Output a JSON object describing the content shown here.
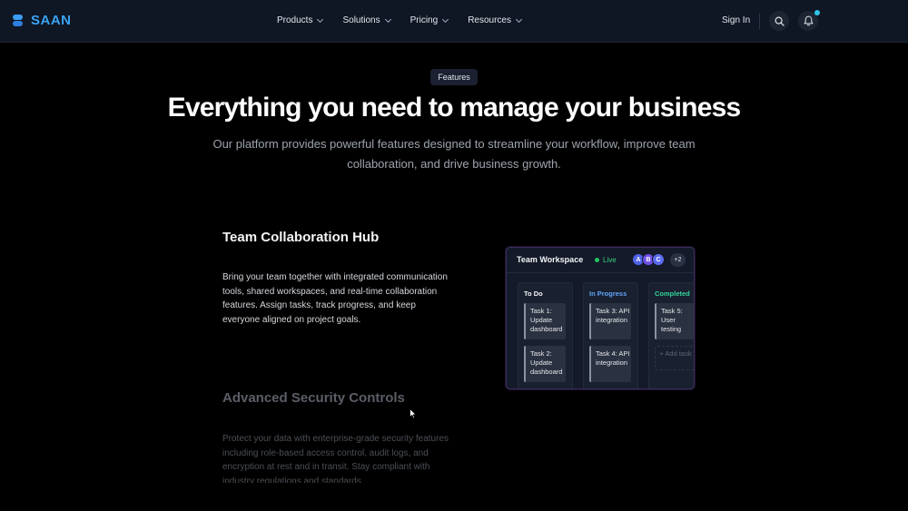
{
  "nav": {
    "logo_text": "SAAN",
    "menu": [
      {
        "label": "Products"
      },
      {
        "label": "Solutions"
      },
      {
        "label": "Pricing"
      },
      {
        "label": "Resources"
      }
    ],
    "sign_in": "Sign In",
    "icons": {
      "search": "search-icon",
      "bell": "bell-icon"
    },
    "accent": "#3aa3f5"
  },
  "hero": {
    "badge": "Features",
    "title": "Everything you need to manage your business",
    "subtitle": "Our platform provides powerful features designed to streamline your workflow, improve team collaboration, and drive business growth."
  },
  "features": [
    {
      "title": "Team Collaboration Hub",
      "description": "Bring your team together with integrated communication tools, shared workspaces, and real-time collaboration features. Assign tasks, track progress, and keep everyone aligned on project goals."
    },
    {
      "title": "Advanced Security Controls",
      "description": "Protect your data with enterprise-grade security features including role-based access control, audit logs, and encryption at rest and in transit. Stay compliant with industry regulations and standards."
    }
  ],
  "workspace": {
    "title": "Team Workspace",
    "status": "Live",
    "avatars": [
      "A",
      "B",
      "C"
    ],
    "more": "+2",
    "columns": [
      {
        "title": "To Do",
        "color": "#f3f4f6",
        "tasks": [
          "Task 1: Update dashboard",
          "Task 2: Update dashboard"
        ]
      },
      {
        "title": "In Progress",
        "color": "#60a5fa",
        "tasks": [
          "Task 3: API integration",
          "Task 4: API integration"
        ]
      },
      {
        "title": "Completed",
        "color": "#34d399",
        "tasks": [
          "Task 5: User testing"
        ],
        "add_label": "+ Add task"
      }
    ]
  }
}
